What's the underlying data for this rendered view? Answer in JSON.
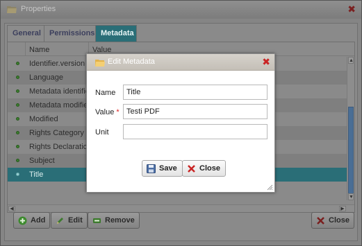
{
  "window": {
    "title": "Properties"
  },
  "tabs": [
    {
      "label": "General",
      "active": false
    },
    {
      "label": "Permissions",
      "active": false
    },
    {
      "label": "Metadata",
      "active": true
    }
  ],
  "grid": {
    "columns": {
      "name": "Name",
      "value": "Value"
    },
    "rows": [
      {
        "name": "Identifier.version",
        "selected": false
      },
      {
        "name": "Language",
        "selected": false
      },
      {
        "name": "Metadata identifier",
        "selected": false
      },
      {
        "name": "Metadata modified",
        "selected": false
      },
      {
        "name": "Modified",
        "selected": false
      },
      {
        "name": "Rights Category",
        "selected": false
      },
      {
        "name": "Rights Declaration",
        "selected": false
      },
      {
        "name": "Subject",
        "selected": false
      },
      {
        "name": "Title",
        "selected": true
      }
    ]
  },
  "buttons": {
    "add": "Add",
    "edit": "Edit",
    "remove": "Remove",
    "close": "Close"
  },
  "dialog": {
    "title": "Edit Metadata",
    "fields": {
      "name_label": "Name",
      "name_value": "Title",
      "value_label": "Value",
      "value_required_mark": "*",
      "value_value": "Testi PDF",
      "unit_label": "Unit",
      "unit_value": ""
    },
    "save_label": "Save",
    "close_label": "Close"
  },
  "colors": {
    "accent": "#2a6e77",
    "close_x": "#c92424"
  }
}
